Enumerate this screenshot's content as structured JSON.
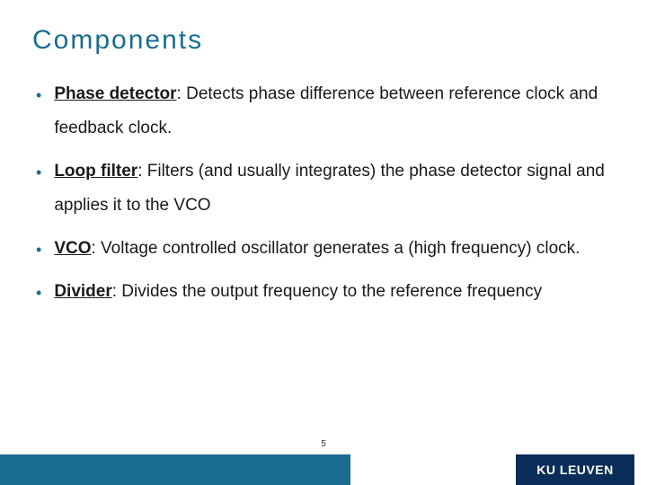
{
  "slide": {
    "title": "Components",
    "bullets": [
      {
        "term": "Phase detector",
        "desc": ": Detects phase difference between reference clock and feedback clock."
      },
      {
        "term": "Loop filter",
        "desc": ": Filters (and usually integrates) the phase detector signal and applies it to the VCO"
      },
      {
        "term": "VCO",
        "desc": ": Voltage controlled oscillator generates a (high frequency) clock."
      },
      {
        "term": "Divider",
        "desc": ": Divides the output frequency to the reference frequency"
      }
    ],
    "page_number": "5",
    "logo": "KU LEUVEN"
  }
}
